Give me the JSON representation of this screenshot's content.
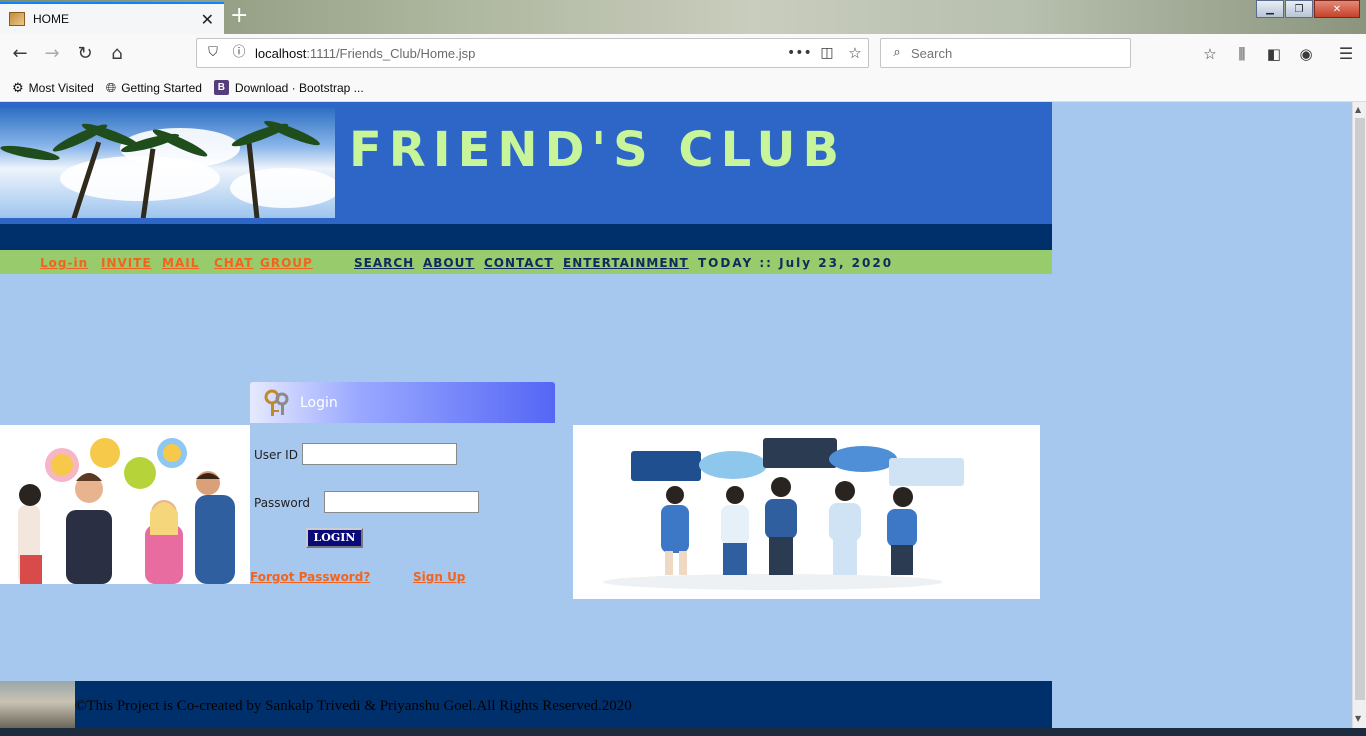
{
  "browser": {
    "tab_title": "HOME",
    "url_host": "localhost",
    "url_path": ":1111/Friends_Club/Home.jsp",
    "search_placeholder": "Search",
    "bookmarks": [
      "Most Visited",
      "Getting Started",
      "Download · Bootstrap ..."
    ]
  },
  "site": {
    "title": "FRIEND'S CLUB",
    "menu_left": [
      "Log-in",
      "INVITE",
      "MAIL",
      "CHAT",
      "GROUP"
    ],
    "menu_right": [
      "SEARCH",
      "ABOUT",
      "CONTACT",
      "ENTERTAINMENT"
    ],
    "today": "TODAY :: July 23, 2020"
  },
  "login": {
    "header": "Login",
    "user_id_label": "User ID",
    "password_label": "Password",
    "button": "LOGIN",
    "forgot": "Forgot Password?",
    "signup": "Sign Up"
  },
  "footer": {
    "text": "©This Project is Co-created by Sankalp Trivedi & Priyanshu Goel.All Rights Reserved.2020"
  },
  "colors": {
    "page_bg": "#a6c8ef",
    "header_bg": "#2d66c6",
    "title_color": "#c8f59a",
    "menubar_bg": "#98cb6b",
    "link_orange": "#f2641e",
    "navy": "#00306b"
  }
}
